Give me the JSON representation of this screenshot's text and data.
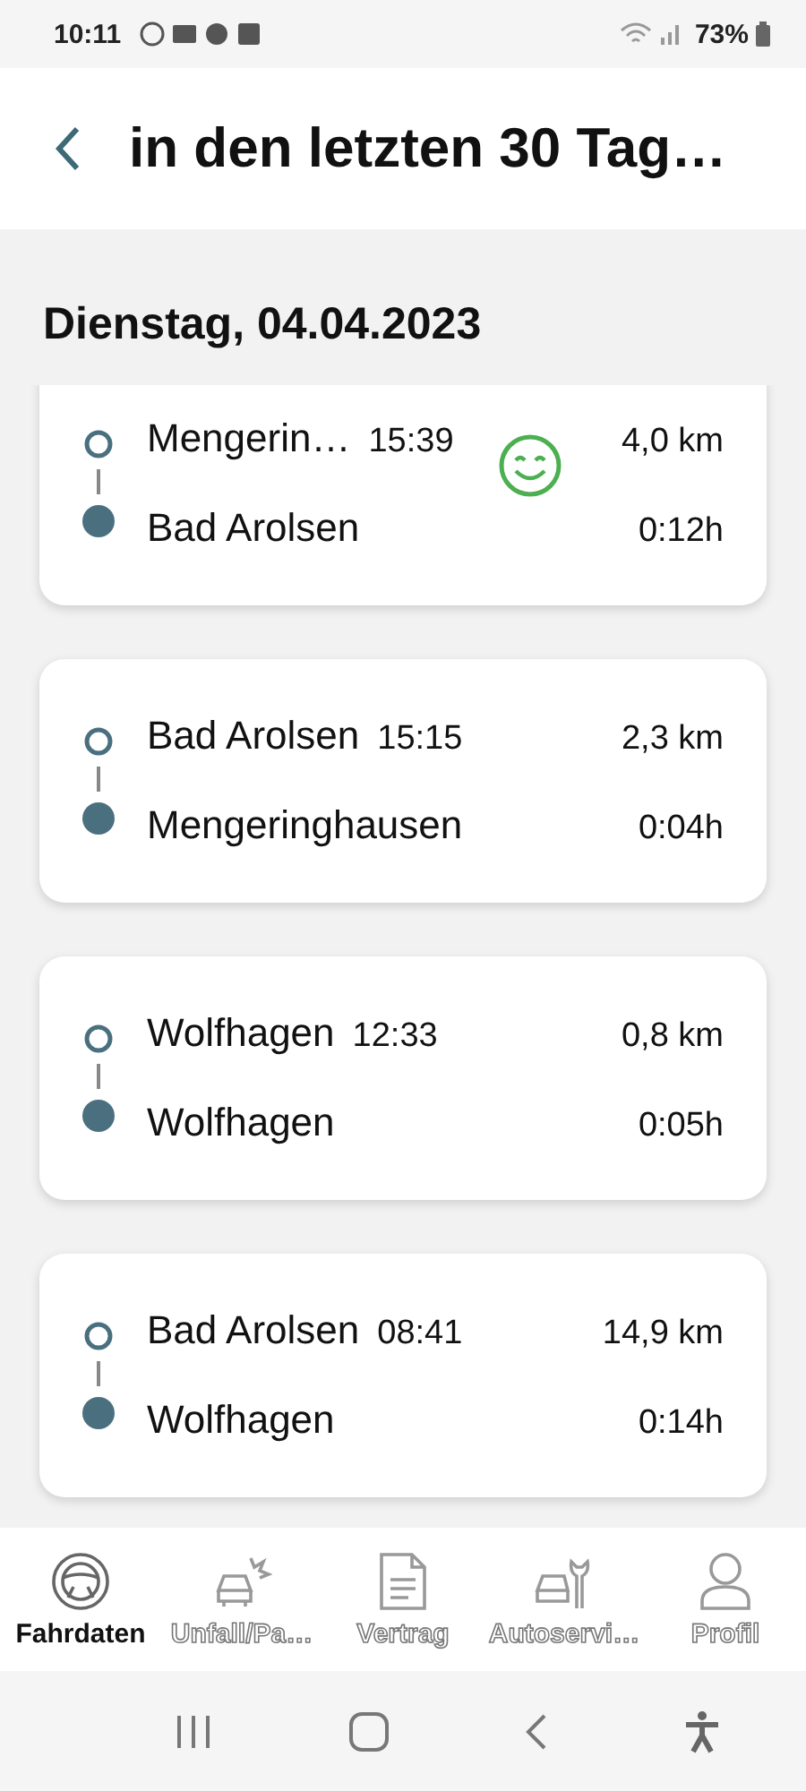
{
  "status_bar": {
    "time": "10:11",
    "battery": "73%"
  },
  "header": {
    "title": "in den letzten 30 Tag…"
  },
  "date": "Dienstag, 04.04.2023",
  "trips": [
    {
      "from": "Mengerin…",
      "time": "15:39",
      "to": "Bad Arolsen",
      "distance": "4,0 km",
      "duration": "0:12h",
      "smiley": true
    },
    {
      "from": "Bad Arolsen",
      "time": "15:15",
      "to": "Mengeringhausen",
      "distance": "2,3 km",
      "duration": "0:04h",
      "smiley": false
    },
    {
      "from": "Wolfhagen",
      "time": "12:33",
      "to": "Wolfhagen",
      "distance": "0,8 km",
      "duration": "0:05h",
      "smiley": false
    },
    {
      "from": "Bad Arolsen",
      "time": "08:41",
      "to": "Wolfhagen",
      "distance": "14,9 km",
      "duration": "0:14h",
      "smiley": false
    }
  ],
  "tabs": [
    {
      "label": "Fahrdaten",
      "kind": "wheel",
      "selected": true
    },
    {
      "label": "Unfall/Pa…",
      "kind": "crash",
      "selected": false
    },
    {
      "label": "Vertrag",
      "kind": "document",
      "selected": false
    },
    {
      "label": "Autoservi…",
      "kind": "service",
      "selected": false
    },
    {
      "label": "Profil",
      "kind": "person",
      "selected": false
    }
  ]
}
